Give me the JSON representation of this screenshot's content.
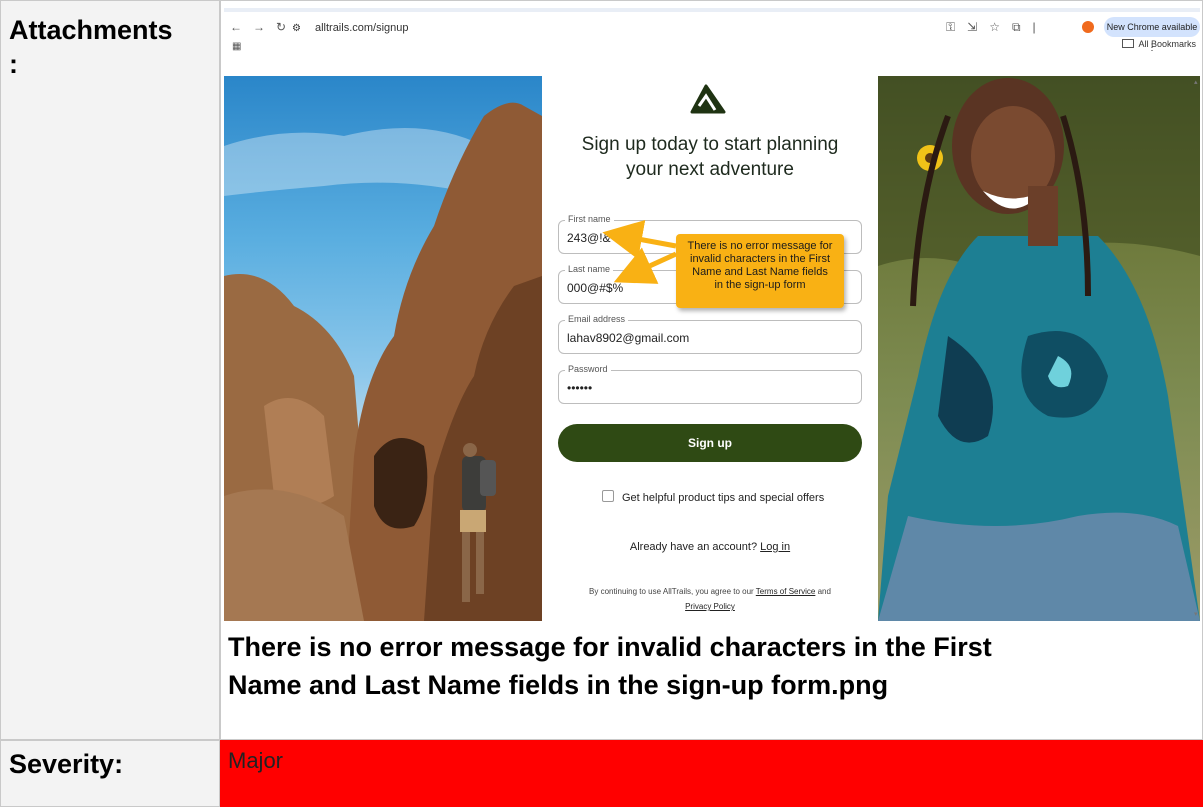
{
  "labels": {
    "attachments": "Attachments",
    "attachments_colon": ":",
    "severity": "Severity:"
  },
  "severity_value": "Major",
  "colors": {
    "severity_bg": "#ff0000",
    "signup_button": "#2f4a14",
    "callout": "#f9b114"
  },
  "caption_line1": "There is no error message for invalid characters in the First",
  "caption_line2": "Name and Last Name fields in the sign-up form.png",
  "browser": {
    "url": "alltrails.com/signup",
    "new_chrome": "New Chrome available",
    "bookmarks": "All Bookmarks",
    "icons": [
      "back-icon",
      "forward-icon",
      "reload-icon",
      "site-info-icon",
      "password-key-icon",
      "install-icon",
      "star-icon",
      "extensions-icon",
      "profile-icon",
      "menu-icon",
      "apps-icon",
      "folder-icon"
    ]
  },
  "form": {
    "heading_line1": "Sign up today to start planning",
    "heading_line2": "your next adventure",
    "first_name_label": "First name",
    "first_name_value": "243@!&",
    "last_name_label": "Last name",
    "last_name_value": "000@#$%",
    "email_label": "Email address",
    "email_value": "lahav8902@gmail.com",
    "password_label": "Password",
    "password_value": "••••••",
    "signup_button": "Sign up",
    "checkbox_label": "Get helpful product tips and special offers",
    "already_text": "Already have an account?",
    "login_link": "Log in",
    "terms_prefix": "By continuing to use AllTrails, you agree to our",
    "terms_link": "Terms of Service",
    "terms_and": "and",
    "privacy_link": "Privacy Policy"
  },
  "callout": {
    "line1": "There is no error message for",
    "line2": "invalid characters in the First",
    "line3": "Name and Last Name fields",
    "line4": "in the sign-up form"
  }
}
